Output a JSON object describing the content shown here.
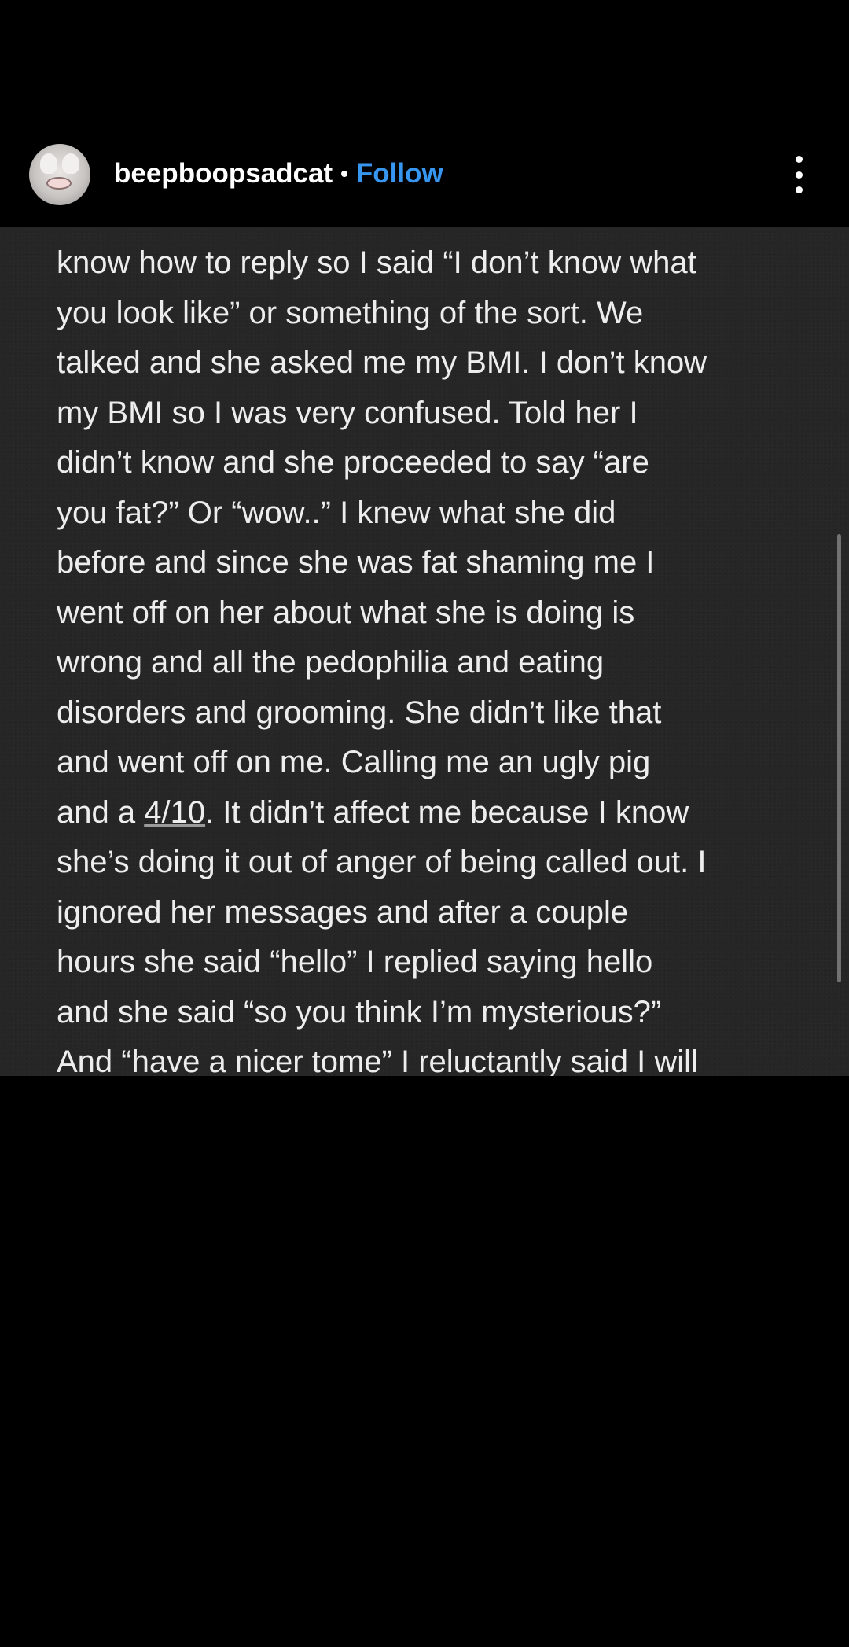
{
  "header": {
    "username": "beepboopsadcat",
    "separator": "•",
    "follow_label": "Follow"
  },
  "post": {
    "lines": [
      "know how to reply so I said “I don’t know what",
      "you look like” or something of the sort. We",
      "talked and she asked me my BMI. I don’t know",
      "my BMI so I was very confused. Told her I",
      "didn’t know and she proceeded to say “are",
      "you fat?” Or “wow..” I knew what she did",
      "before and since she was fat shaming me I",
      "went off on her about what she is doing is",
      "wrong and all the pedophilia and eating",
      "disorders and grooming. She didn’t like that",
      "and went off on me. Calling me an ugly pig",
      "and a ",
      "she’s doing it out of anger of being called out. I",
      "ignored her messages and after a couple",
      "hours she said “hello” I replied saying hello",
      "and she said “so you think I’m mysterious?”",
      "And “have a nicer tome” I reluctantly said I will"
    ],
    "underlined_rating": "4/10",
    "line12_rest": ". It didn’t affect me because I know"
  }
}
